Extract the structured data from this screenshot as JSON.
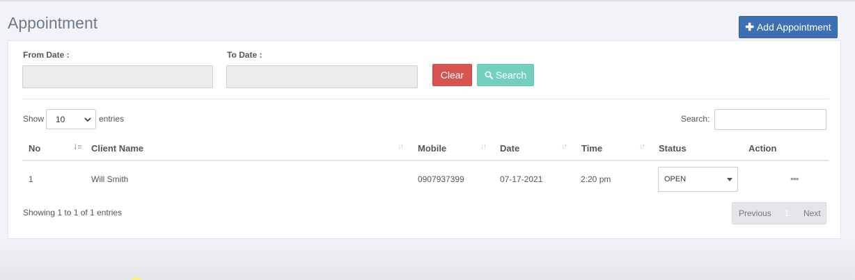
{
  "page": {
    "title": "Appointment"
  },
  "toolbar": {
    "add_label": "Add Appointment"
  },
  "filters": {
    "from_label": "From Date :",
    "to_label": "To Date :",
    "from_value": "",
    "to_value": "",
    "clear_label": "Clear",
    "search_label": "Search"
  },
  "table_controls": {
    "show_label": "Show",
    "entries_value": "10",
    "entries_label": "entries",
    "search_label": "Search:",
    "search_value": ""
  },
  "table": {
    "headers": [
      "No",
      "Client Name",
      "Mobile",
      "Date",
      "Time",
      "Status",
      "Action"
    ],
    "rows": [
      {
        "no": "1",
        "client_name": "Will Smith",
        "mobile": "0907937399",
        "date": "07-17-2021",
        "time": "2:20 pm",
        "status": "OPEN"
      }
    ]
  },
  "footer": {
    "info": "Showing 1 to 1 of 1 entries",
    "prev_label": "Previous",
    "page": "1",
    "next_label": "Next"
  },
  "colors": {
    "primary": "#3d6fb3",
    "danger": "#d9534f",
    "search": "#72d0bd"
  }
}
